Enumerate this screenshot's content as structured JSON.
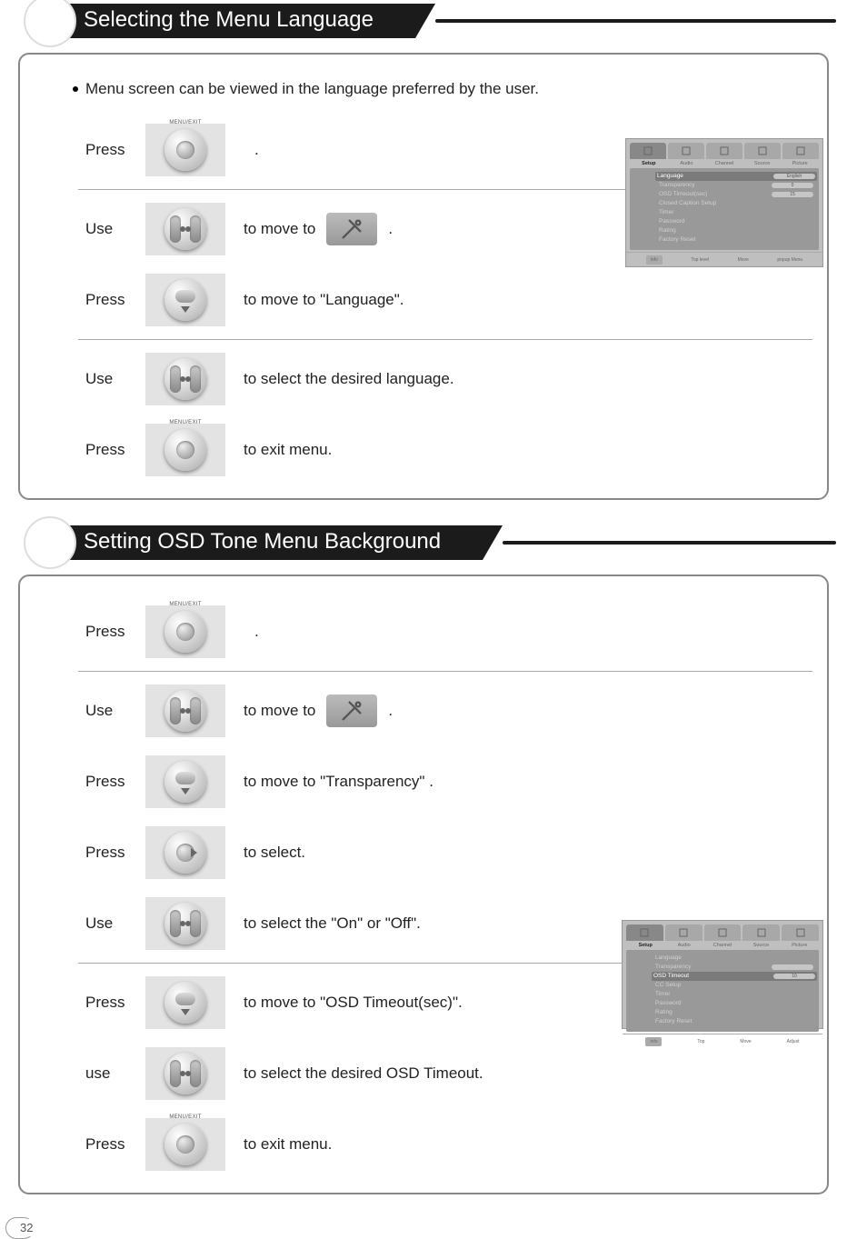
{
  "page_number": "32",
  "section1": {
    "title": "Selecting the Menu Language",
    "intro_bullet": "Menu screen can be viewed in the language preferred by the user.",
    "steps": [
      {
        "verb": "Press",
        "btn": "menu",
        "desc_before": "",
        "desc_after": ".",
        "has_setup_icon": false
      },
      {
        "verb": "Use",
        "btn": "leftright",
        "desc_before": "to move to",
        "desc_after": ".",
        "has_setup_icon": true
      },
      {
        "verb": "Press",
        "btn": "down",
        "desc_before": "to move to \"Language\".",
        "desc_after": "",
        "has_setup_icon": false
      },
      {
        "verb": "Use",
        "btn": "leftright",
        "desc_before": "to select the desired language.",
        "desc_after": "",
        "has_setup_icon": false
      },
      {
        "verb": "Press",
        "btn": "menu",
        "desc_before": "to exit menu.",
        "desc_after": "",
        "has_setup_icon": false
      }
    ],
    "osd": {
      "tabs": [
        "Setup",
        "Audio",
        "Channel",
        "Source",
        "Picture"
      ],
      "selected_tab": 0,
      "items": [
        {
          "label": "Language",
          "value": "English",
          "highlight": true,
          "pill": true
        },
        {
          "label": "Transparency",
          "value": "0",
          "pill": true
        },
        {
          "label": "OSD Timeout(sec)",
          "value": "15",
          "pill": true
        },
        {
          "label": "Closed Caption Setup",
          "value": ""
        },
        {
          "label": "Timer",
          "value": ""
        },
        {
          "label": "Password",
          "value": ""
        },
        {
          "label": "Rating",
          "value": ""
        },
        {
          "label": "Factory Reset",
          "value": ""
        }
      ],
      "footer": [
        "info",
        "Top level",
        "Move",
        "popup Menu"
      ]
    }
  },
  "section2": {
    "title": "Setting OSD Tone Menu Background",
    "steps": [
      {
        "verb": "Press",
        "btn": "menu",
        "desc_before": "",
        "desc_after": ".",
        "has_setup_icon": false
      },
      {
        "verb": "Use",
        "btn": "leftright",
        "desc_before": "to move to",
        "desc_after": ".",
        "has_setup_icon": true
      },
      {
        "verb": "Press",
        "btn": "down",
        "desc_before": "to move to \"Transparency\" .",
        "desc_after": "",
        "has_setup_icon": false
      },
      {
        "verb": "Press",
        "btn": "right",
        "desc_before": "to select.",
        "desc_after": "",
        "has_setup_icon": false
      },
      {
        "verb": "Use",
        "btn": "leftright",
        "desc_before": "to select the \"On\" or \"Off\".",
        "desc_after": "",
        "has_setup_icon": false
      },
      {
        "verb": "Press",
        "btn": "down",
        "desc_before": "to move to \"OSD Timeout(sec)\".",
        "desc_after": "",
        "has_setup_icon": false
      },
      {
        "verb": "use",
        "btn": "leftright",
        "desc_before": "to select the desired OSD Timeout.",
        "desc_after": "",
        "has_setup_icon": false
      },
      {
        "verb": "Press",
        "btn": "menu",
        "desc_before": "to exit menu.",
        "desc_after": "",
        "has_setup_icon": false
      }
    ],
    "osd": {
      "tabs": [
        "Setup",
        "Audio",
        "Channel",
        "Source",
        "Picture"
      ],
      "selected_tab": 0,
      "items": [
        {
          "label": "Language",
          "value": ""
        },
        {
          "label": "Transparency",
          "value": "",
          "pill": true
        },
        {
          "label": "OSD Timeout",
          "value": "10",
          "highlight": true,
          "pill": true
        },
        {
          "label": "CC Setup",
          "value": ""
        },
        {
          "label": "Timer",
          "value": ""
        },
        {
          "label": "Password",
          "value": ""
        },
        {
          "label": "Rating",
          "value": ""
        },
        {
          "label": "Factory Reset",
          "value": ""
        }
      ],
      "footer": [
        "info",
        "Top",
        "Move",
        "Adjust"
      ]
    }
  }
}
